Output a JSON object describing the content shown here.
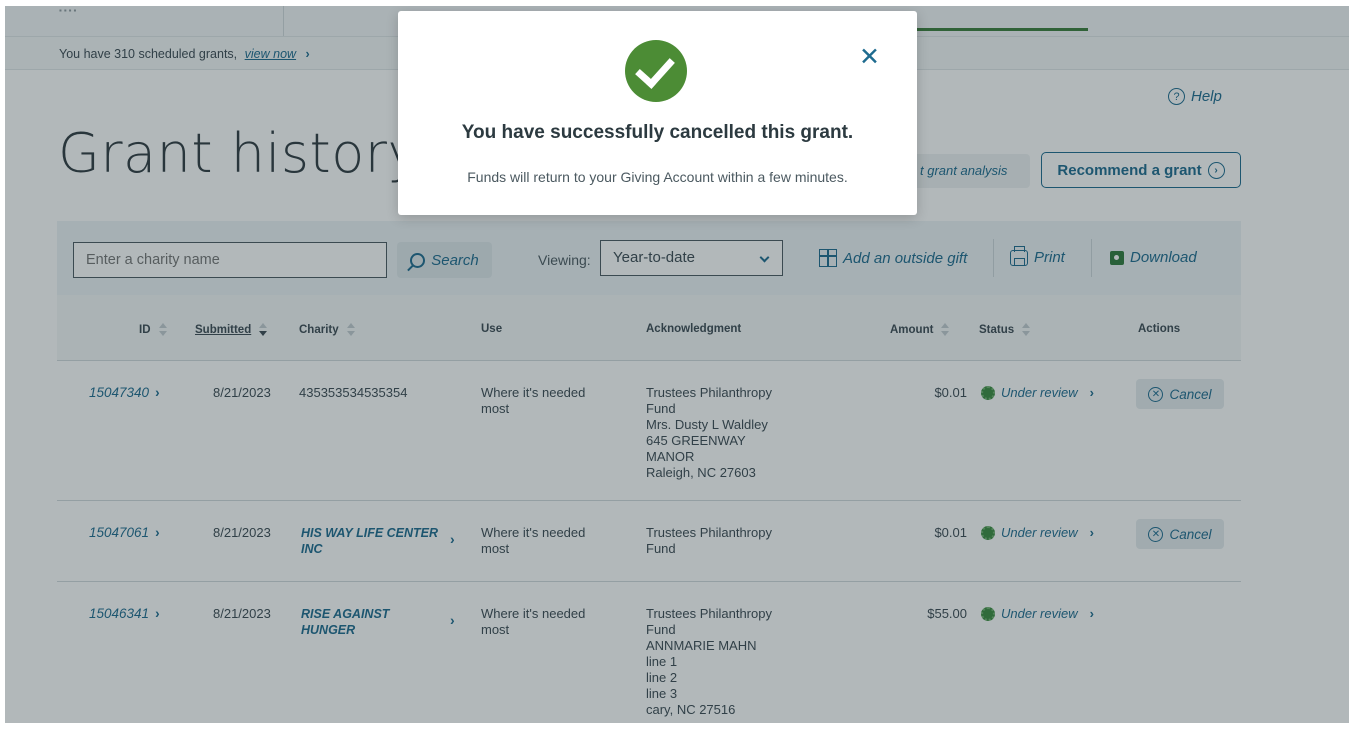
{
  "scheduled": {
    "text": "You have 310 scheduled grants,",
    "link": "view now",
    "chevron": "›"
  },
  "help": {
    "icon": "?",
    "label": "Help"
  },
  "page_title": "Grant history",
  "actions": {
    "grant_analysis": "t grant analysis",
    "recommend": "Recommend a grant",
    "recommend_icon": "›"
  },
  "toolbar": {
    "charity_placeholder": "Enter a charity name",
    "search_label": "Search",
    "viewing_label": "Viewing:",
    "viewing_value": "Year-to-date",
    "add_gift": "Add an outside gift",
    "print": "Print",
    "download": "Download"
  },
  "columns": {
    "id": "ID",
    "submitted": "Submitted",
    "charity": "Charity",
    "use": "Use",
    "acknowledgment": "Acknowledgment",
    "amount": "Amount",
    "status": "Status",
    "actions": "Actions"
  },
  "rows": [
    {
      "id": "15047340",
      "submitted": "8/21/2023",
      "charity": "435353534535354",
      "use": "Where it's needed most",
      "ack": "Trustees Philanthropy\nFund\nMrs. Dusty L Waldley\n645 GREENWAY\nMANOR\nRaleigh, NC 27603",
      "amount": "$0.01",
      "status": "Under review",
      "action": "Cancel"
    },
    {
      "id": "15047061",
      "submitted": "8/21/2023",
      "charity": "HIS WAY LIFE CENTER INC",
      "use": "Where it's needed most",
      "ack": "Trustees Philanthropy\nFund",
      "amount": "$0.01",
      "status": "Under review",
      "action": "Cancel"
    },
    {
      "id": "15046341",
      "submitted": "8/21/2023",
      "charity": "RISE AGAINST HUNGER",
      "use": "Where it's needed most",
      "ack": "Trustees Philanthropy\nFund\nANNMARIE MAHN\nline 1\nline 2\nline 3\ncary, NC 27516",
      "amount": "$55.00",
      "status": "Under review",
      "action": ""
    }
  ],
  "modal": {
    "title": "You have successfully cancelled this grant.",
    "message": "Funds will return to your Giving Account within a few minutes.",
    "close": "✕"
  },
  "colors": {
    "brand_blue": "#1e6b8f",
    "success_green": "#4c8c35"
  }
}
